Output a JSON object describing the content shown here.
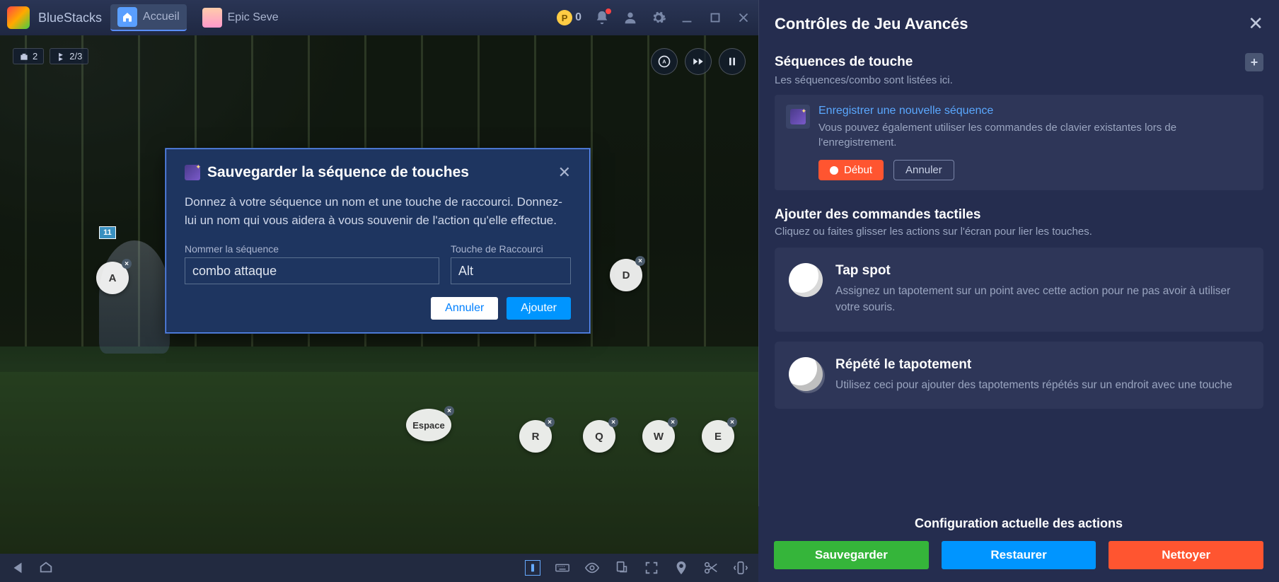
{
  "app": {
    "name": "BlueStacks",
    "coin_value": "0"
  },
  "tabs": [
    {
      "label": "Accueil"
    },
    {
      "label": "Epic Seve"
    }
  ],
  "hud": {
    "chip1": "2",
    "chip2": "2/3",
    "char_level": "11"
  },
  "spots": {
    "A": "A",
    "D": "D",
    "Space": "Espace",
    "R": "R",
    "Q": "Q",
    "W": "W",
    "E": "E"
  },
  "dialog": {
    "title": "Sauvegarder la séquence de touches",
    "text": "Donnez à votre séquence un nom et une touche de raccourci. Donnez-lui un nom qui vous aidera à vous souvenir de l'action qu'elle effectue.",
    "name_label": "Nommer la séquence",
    "name_value": "combo attaque",
    "key_label": "Touche de Raccourci",
    "key_value": "Alt",
    "cancel": "Annuler",
    "add": "Ajouter"
  },
  "panel": {
    "title": "Contrôles de Jeu Avancés",
    "seq_title": "Séquences de touche",
    "seq_sub": "Les séquences/combo sont listées ici.",
    "rec_link": "Enregistrer une nouvelle séquence",
    "rec_desc": "Vous pouvez également utiliser les commandes de clavier existantes lors de l'enregistrement.",
    "rec_start": "Début",
    "rec_cancel": "Annuler",
    "tac_title": "Ajouter des commandes tactiles",
    "tac_sub": "Cliquez ou faites glisser les actions sur l'écran pour lier les touches.",
    "tap_title": "Tap spot",
    "tap_desc": "Assignez un tapotement sur un point avec cette action pour ne pas avoir à utiliser votre souris.",
    "rep_title": "Répété le tapotement",
    "rep_desc": "Utilisez ceci pour ajouter des tapotements répétés sur un endroit avec une touche",
    "config": "Configuration actuelle des actions",
    "save": "Sauvegarder",
    "restore": "Restaurer",
    "clean": "Nettoyer"
  }
}
